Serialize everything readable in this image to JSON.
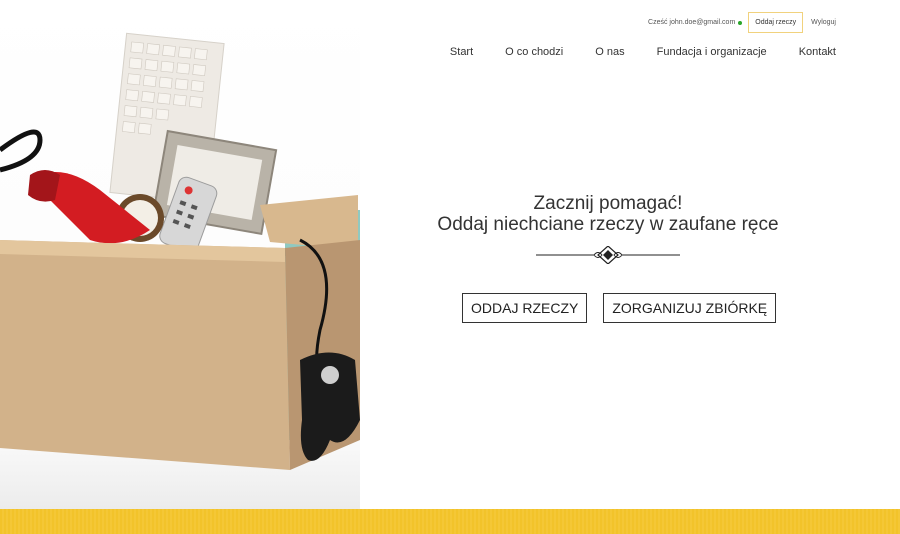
{
  "header": {
    "greeting": "Cześć john.doe@gmail.com",
    "give_button": "Oddaj rzeczy",
    "logout": "Wyloguj",
    "status_color": "#2aa52a",
    "give_button_border": "#f1d27d"
  },
  "nav": {
    "items": [
      "Start",
      "O co chodzi",
      "O nas",
      "Fundacja i organizacje",
      "Kontakt"
    ]
  },
  "hero": {
    "line1": "Zacznij pomagać!",
    "line2": "Oddaj niechciane rzeczy w zaufane ręce",
    "cta_give": "ODDAJ RZECZY",
    "cta_organize": "ZORGANIZUJ ZBIÓRKĘ",
    "image": "cardboard-box-with-unwanted-items",
    "ornament": "decorative-divider-icon"
  },
  "footer": {
    "band_color": "#f2c32a"
  }
}
